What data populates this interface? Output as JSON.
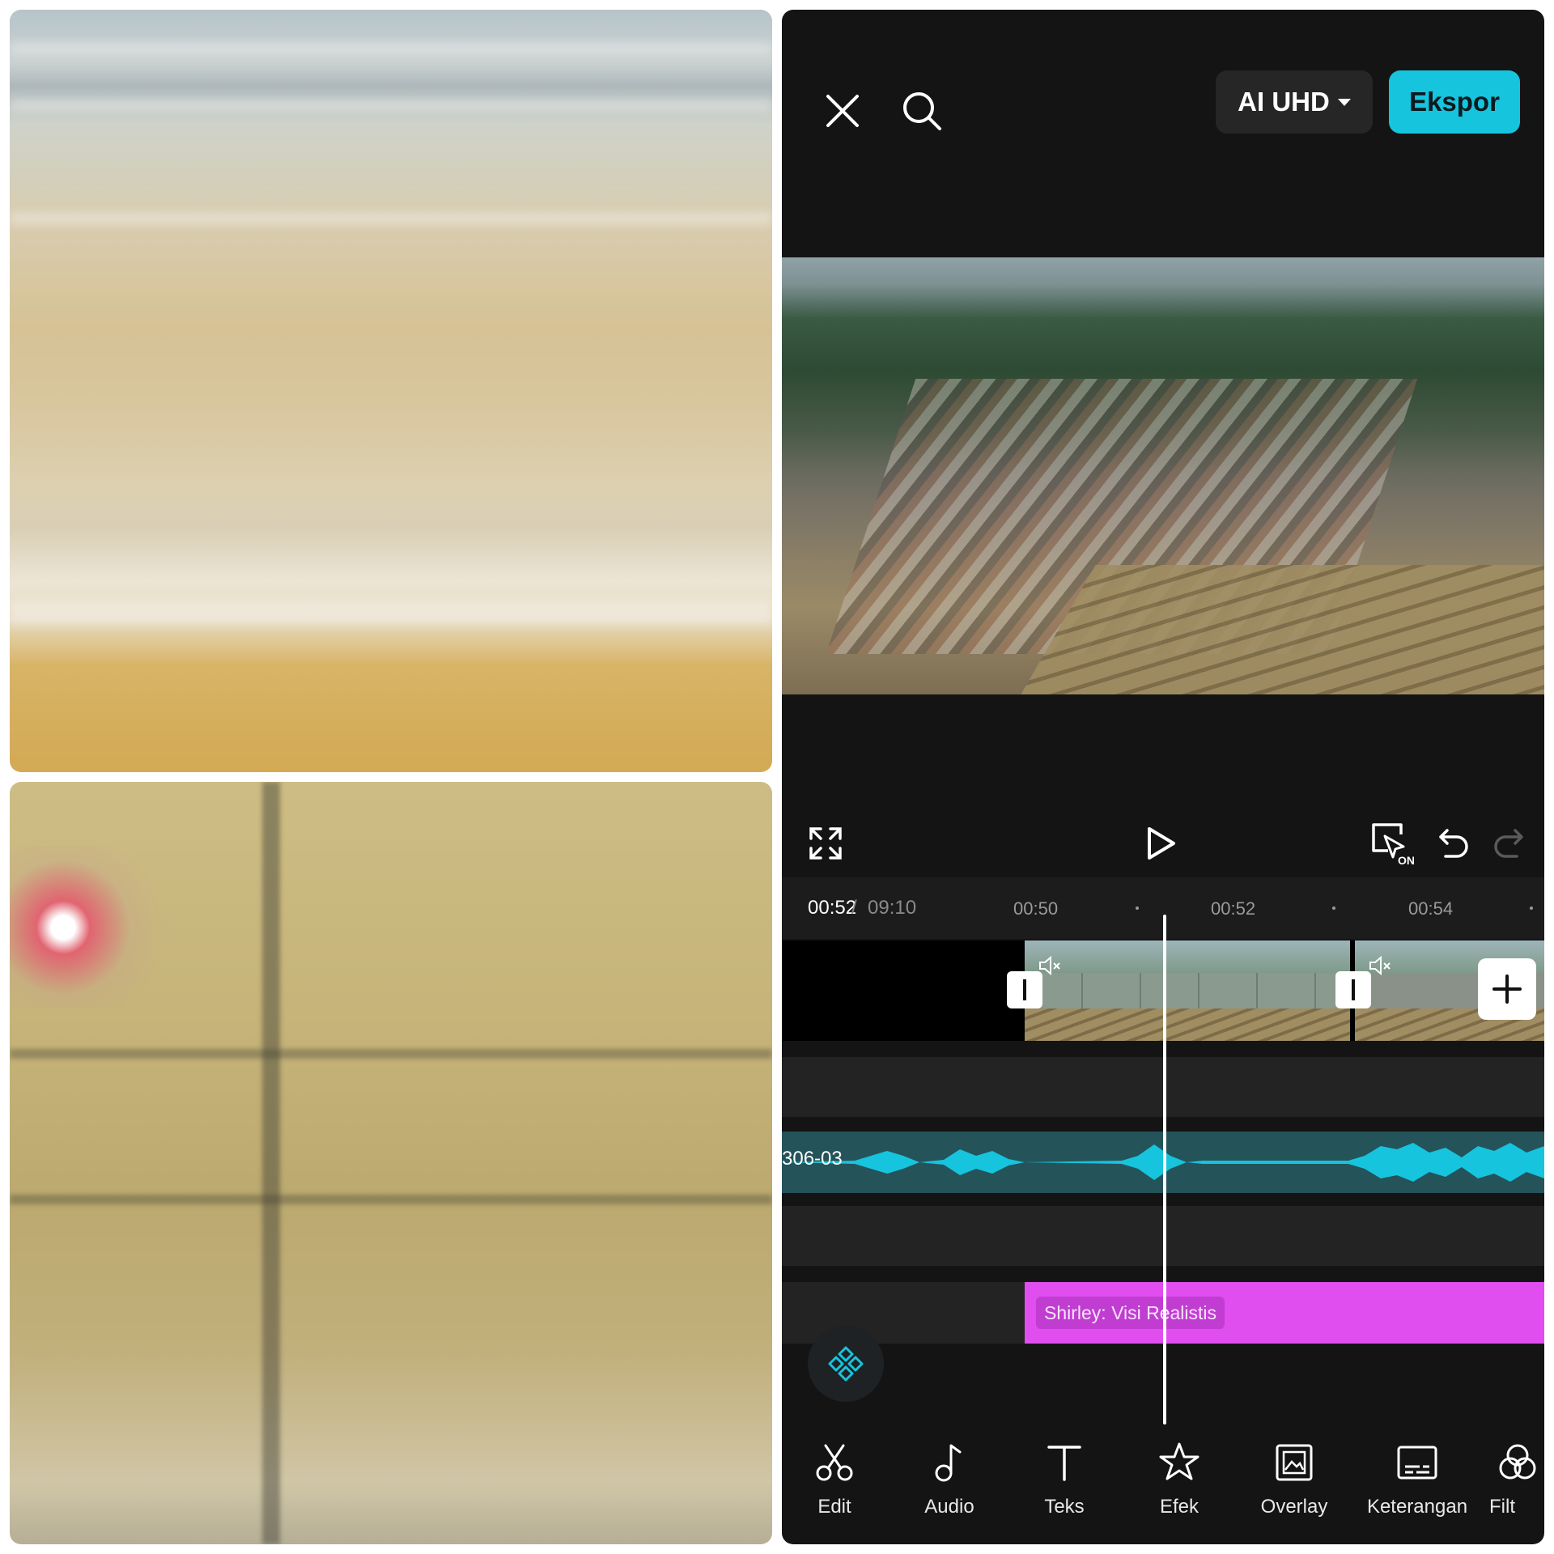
{
  "editor": {
    "quality_label": "AI UHD",
    "export_label": "Ekspor",
    "time_current": "00:52",
    "time_separator": "/",
    "time_total": "09:10",
    "ruler_ticks": [
      "00:50",
      "00:52",
      "00:54"
    ],
    "keyframe_badge": "ON",
    "audio_clip_label": "306-03",
    "effect_clip_label": "Shirley: Visi Realistis",
    "accent_color": "#16c4dd",
    "effect_color": "#e04ef0",
    "toolbar": [
      {
        "label": "Edit",
        "icon": "scissors-icon"
      },
      {
        "label": "Audio",
        "icon": "music-note-icon"
      },
      {
        "label": "Teks",
        "icon": "text-icon"
      },
      {
        "label": "Efek",
        "icon": "sparkle-star-icon"
      },
      {
        "label": "Overlay",
        "icon": "overlay-image-icon"
      },
      {
        "label": "Keterangan",
        "icon": "captions-icon"
      },
      {
        "label": "Filt",
        "icon": "filter-icon"
      }
    ]
  }
}
